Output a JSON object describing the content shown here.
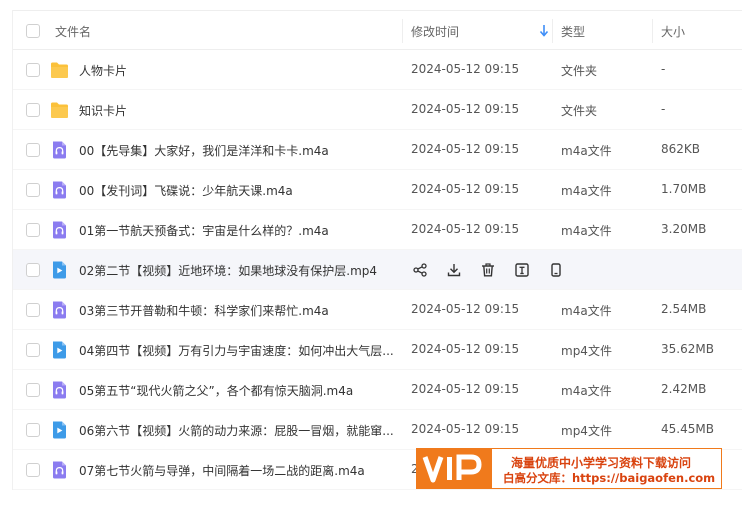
{
  "header": {
    "name_col": "文件名",
    "date_col": "修改时间",
    "type_col": "类型",
    "size_col": "大小"
  },
  "files": [
    {
      "name": "人物卡片",
      "date": "2024-05-12 09:15",
      "type": "文件夹",
      "size": "-",
      "icon": "folder-icon"
    },
    {
      "name": "知识卡片",
      "date": "2024-05-12 09:15",
      "type": "文件夹",
      "size": "-",
      "icon": "folder-icon"
    },
    {
      "name": "00【先导集】大家好，我们是洋洋和卡卡.m4a",
      "date": "2024-05-12 09:15",
      "type": "m4a文件",
      "size": "862KB",
      "icon": "audio-file-icon"
    },
    {
      "name": "00【发刊词】飞碟说：少年航天课.m4a",
      "date": "2024-05-12 09:15",
      "type": "m4a文件",
      "size": "1.70MB",
      "icon": "audio-file-icon"
    },
    {
      "name": "01第一节航天预备式：宇宙是什么样的？.m4a",
      "date": "2024-05-12 09:15",
      "type": "m4a文件",
      "size": "3.20MB",
      "icon": "audio-file-icon"
    },
    {
      "name": "02第二节【视频】近地环境：如果地球没有保护层.mp4",
      "date": "",
      "type": "",
      "size": "",
      "icon": "video-file-icon"
    },
    {
      "name": "03第三节开普勒和牛顿：科学家们来帮忙.m4a",
      "date": "2024-05-12 09:15",
      "type": "m4a文件",
      "size": "2.54MB",
      "icon": "audio-file-icon"
    },
    {
      "name": "04第四节【视频】万有引力与宇宙速度：如何冲出大气层...",
      "date": "2024-05-12 09:15",
      "type": "mp4文件",
      "size": "35.62MB",
      "icon": "video-file-icon"
    },
    {
      "name": "05第五节“现代火箭之父”，各个都有惊天脑洞.m4a",
      "date": "2024-05-12 09:15",
      "type": "m4a文件",
      "size": "2.42MB",
      "icon": "audio-file-icon"
    },
    {
      "name": "06第六节【视频】火箭的动力来源：屁股一冒烟，就能窜...",
      "date": "2024-05-12 09:15",
      "type": "mp4文件",
      "size": "45.45MB",
      "icon": "video-file-icon"
    },
    {
      "name": "07第七节火箭与导弹，中间隔着一场二战的距离.m4a",
      "date": "2",
      "type": "",
      "size": "",
      "icon": "audio-file-icon"
    }
  ],
  "hover_actions": [
    "share-icon",
    "download-icon",
    "delete-icon",
    "rename-icon",
    "more-icon"
  ],
  "watermark": {
    "logo_text": "VIP",
    "line1": "海量优质中小学学习资料下载访问",
    "line2": "白高分文库：https://baigaofen.com"
  },
  "colors": {
    "folder": "#fbc13a",
    "audio": "#8b7cf0",
    "video": "#3e9be8",
    "watermark": "#f07a1c"
  }
}
